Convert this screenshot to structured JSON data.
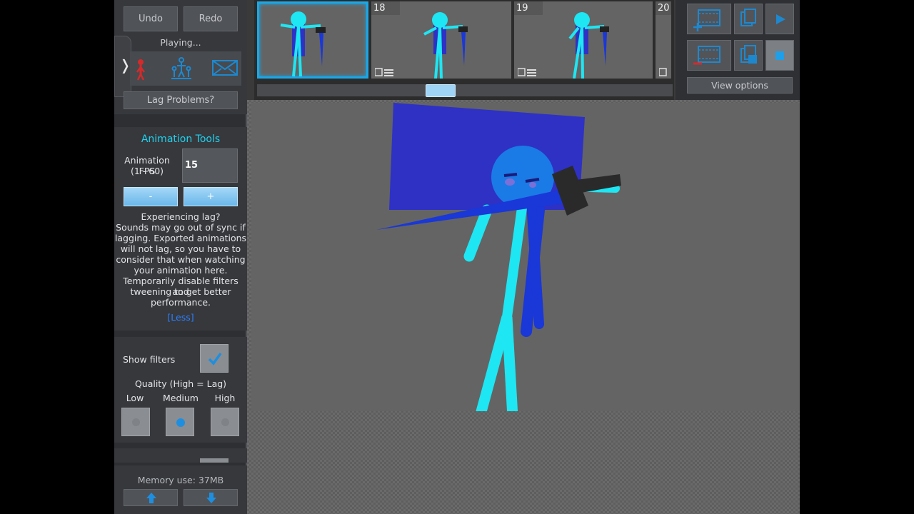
{
  "header": {
    "undo_label": "Undo",
    "redo_label": "Redo",
    "status": "Playing...",
    "expand_glyph": "❭",
    "lag_button": "Lag Problems?"
  },
  "animation_tools": {
    "title": "Animation Tools",
    "fps_label_line1": "Animation FPS",
    "fps_label_line2": "(1 - 60)",
    "fps_value": "15",
    "minus_label": "-",
    "plus_label": "+",
    "lag_info": [
      "Experiencing lag?",
      "Sounds may go out of sync if",
      "lagging. Exported animations",
      "will not lag, so you have to",
      "consider that when watching",
      "your animation here.",
      "Temporarily disable filters and",
      "tweening to get better",
      "performance."
    ],
    "less_link": "[Less]"
  },
  "filters": {
    "show_filters_label": "Show filters",
    "show_filters_checked": true,
    "quality_label": "Quality (High = Lag)",
    "quality_options": [
      "Low",
      "Medium",
      "High"
    ],
    "quality_selected": "Medium"
  },
  "footer": {
    "memory": "Memory use: 37MB"
  },
  "timeline": {
    "frame_numbers": [
      "18",
      "19",
      "20"
    ]
  },
  "right_panel": {
    "view_options": "View options"
  },
  "colors": {
    "accent": "#19a8e8",
    "figure_cyan": "#1ee6f2",
    "figure_blue": "#1a37d8",
    "cape": "#2e31c4",
    "link_blue": "#2d7fff",
    "mode_red": "#d62a2a"
  }
}
